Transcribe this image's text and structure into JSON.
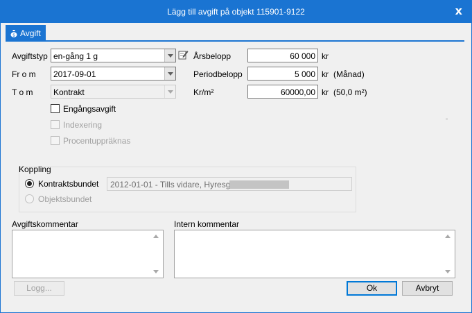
{
  "window": {
    "title": "Lägg till avgift på objekt 115901-9122",
    "close_label": "x"
  },
  "tab": {
    "label": "Avgift",
    "icon": "money-bag-icon"
  },
  "form": {
    "avgiftstyp_label": "Avgiftstyp",
    "avgiftstyp_value": "en-gång   1 g",
    "from_label": "Fr o m",
    "from_value": "2017-09-01",
    "tom_label": "T o m",
    "tom_value": "Kontrakt",
    "engangs_label": "Engångsavgift",
    "indexering_label": "Indexering",
    "procent_label": "Procentuppräknas",
    "arsbelopp_label": "Årsbelopp",
    "arsbelopp_value": "60 000",
    "arsbelopp_unit": "kr",
    "period_label": "Periodbelopp",
    "period_value": "5 000",
    "period_unit": "kr",
    "period_suffix": "(Månad)",
    "krm2_label": "Kr/m²",
    "krm2_value": "60000,00",
    "krm2_unit": "kr",
    "krm2_suffix": "(50,0 m²)"
  },
  "koppling": {
    "title": "Koppling",
    "kontrakt_label": "Kontraktsbundet",
    "objekt_label": "Objektsbundet",
    "info_text": "2012-01-01 - Tills vidare, Hyresgäst:"
  },
  "comments": {
    "avgift_label": "Avgiftskommentar",
    "intern_label": "Intern kommentar"
  },
  "buttons": {
    "log_label": "Logg...",
    "ok_label": "Ok",
    "cancel_label": "Avbryt"
  },
  "colors": {
    "accent": "#1a74d2",
    "disabled_text": "#a0a0a0"
  }
}
